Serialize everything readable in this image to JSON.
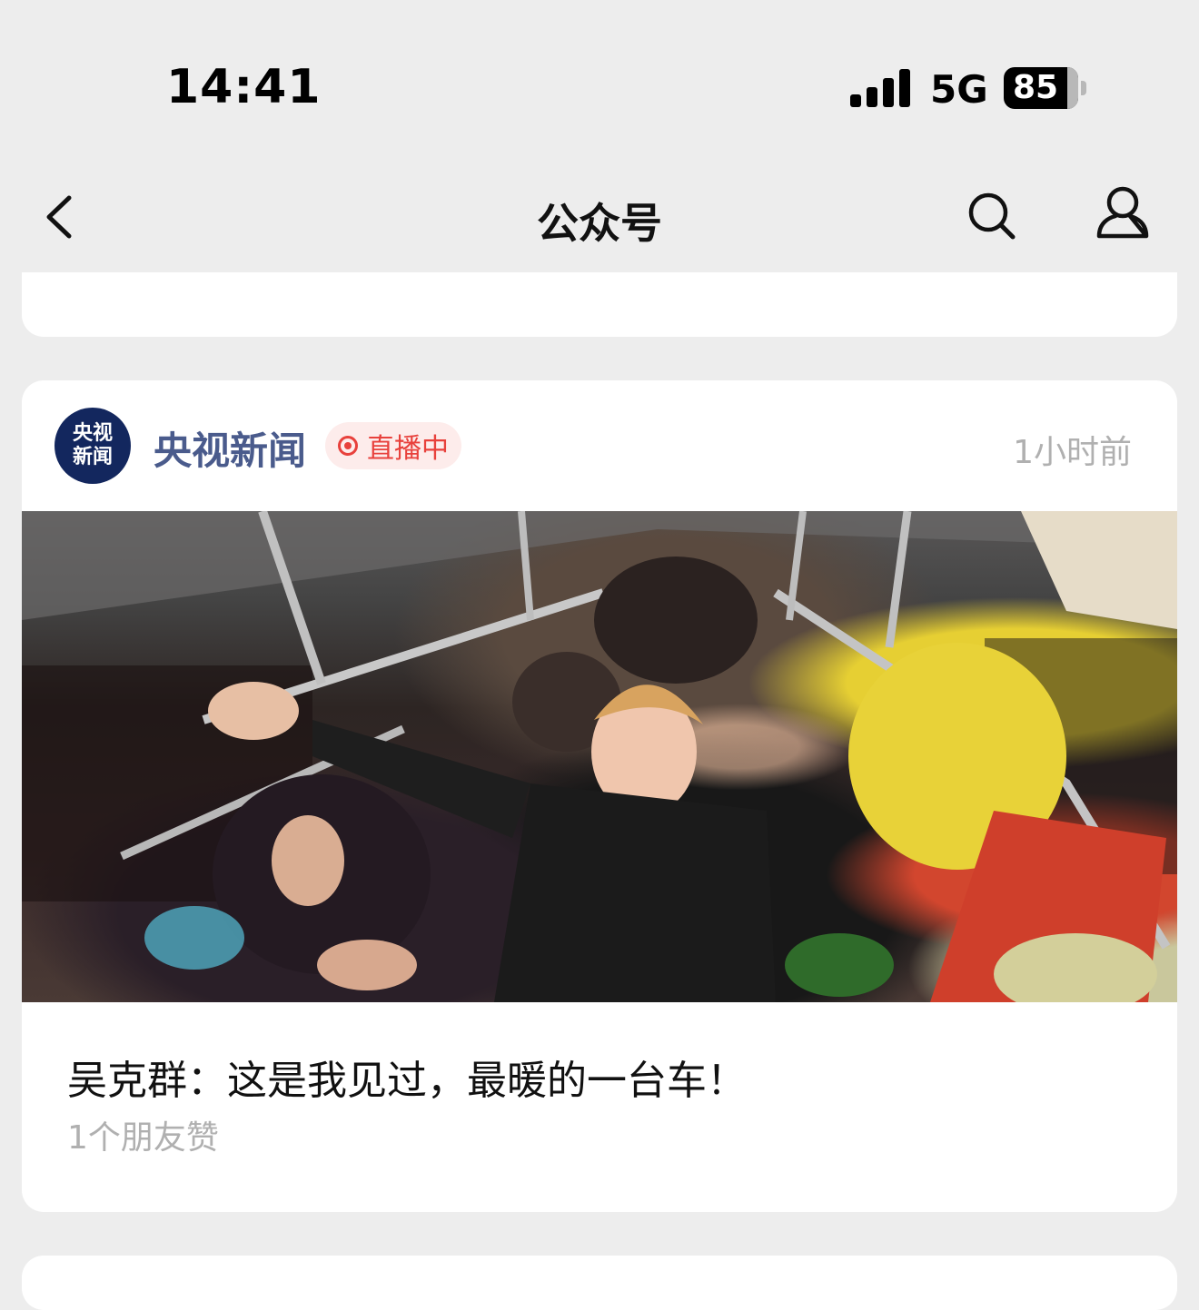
{
  "status_bar": {
    "time": "14:41",
    "network": "5G",
    "battery": "85",
    "battery_level": 0.85,
    "signal_bars": 4
  },
  "nav": {
    "title": "公众号",
    "icons": [
      "chevron-left-icon",
      "search-icon",
      "person-icon"
    ]
  },
  "article": {
    "account_name": "央视新闻",
    "avatar_text": "央视新闻",
    "live_badge": "直播中",
    "time": "1小时前",
    "title": "吴克群：这是我见过，最暖的一台车！",
    "likes": "1个朋友赞"
  },
  "colors": {
    "background": "#ededed",
    "card": "#ffffff",
    "account_name": "#4a5b8c",
    "live_red": "#e8413c",
    "avatar_navy": "#13275e",
    "muted_text": "#b0b0b0"
  }
}
